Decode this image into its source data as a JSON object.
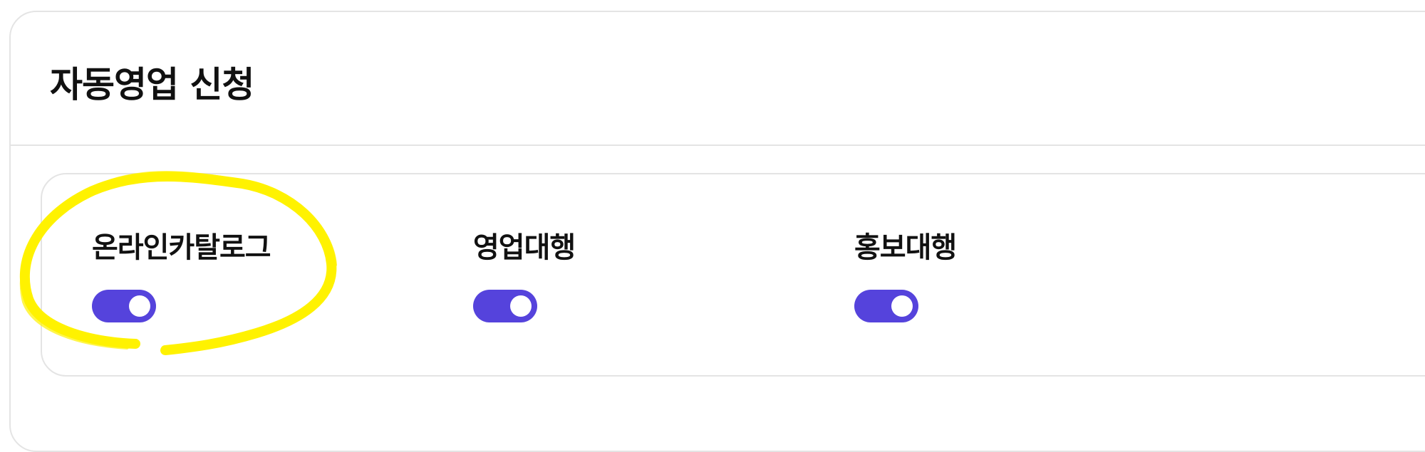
{
  "card": {
    "title": "자동영업 신청"
  },
  "options": [
    {
      "label": "온라인카탈로그",
      "enabled": true
    },
    {
      "label": "영업대행",
      "enabled": true
    },
    {
      "label": "홍보대행",
      "enabled": true
    }
  ],
  "colors": {
    "toggle_on": "#5543dc",
    "highlight": "#fff200",
    "border": "#e4e4e4"
  }
}
